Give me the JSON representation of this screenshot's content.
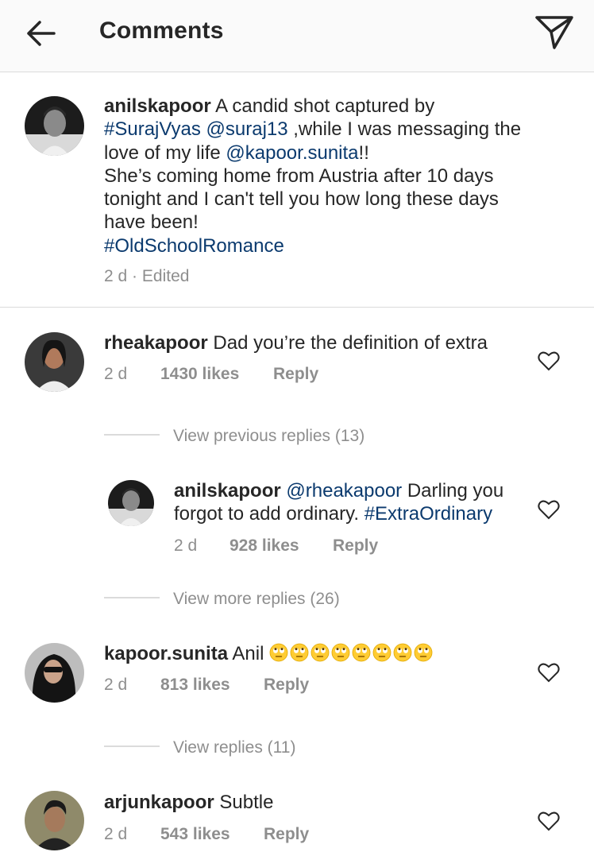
{
  "header": {
    "title": "Comments",
    "back_icon": "arrow-left-icon",
    "share_icon": "paper-plane-icon"
  },
  "caption": {
    "username": "anilskapoor",
    "text_1": " A candid shot captured by",
    "tag_1": "#SurajVyas",
    "mention_1": "@suraj13",
    "text_2": " ,while I was messaging the",
    "text_3": "love of my life ",
    "mention_2": "@kapoor.sunita",
    "text_4": "!!",
    "line_4": "She’s coming home from Austria after 10 days",
    "line_5": "tonight and I can't tell you how long these days",
    "line_6": "have been!",
    "tag_2": "#OldSchoolRomance",
    "time": "2 d",
    "separator": "·",
    "edited": "Edited"
  },
  "comments": [
    {
      "username": "rheakapoor",
      "text": " Dad you’re the definition of extra",
      "time": "2 d",
      "likes": "1430 likes",
      "reply": "Reply",
      "view_replies": "View previous replies (13)"
    },
    {
      "username": "kapoor.sunita",
      "text": " Anil ",
      "emoji": "face-with-rolling-eyes",
      "emoji_count": 8,
      "time": "2 d",
      "likes": "813 likes",
      "reply": "Reply",
      "view_replies": "View replies (11)"
    },
    {
      "username": "arjunkapoor",
      "text": " Subtle",
      "time": "2 d",
      "likes": "543 likes",
      "reply": "Reply"
    }
  ],
  "reply": {
    "username": "anilskapoor",
    "mention": "@rheakapoor",
    "text_1": " Darling you",
    "text_2": "forgot to add ordinary. ",
    "tag": "#ExtraOrdinary",
    "time": "2 d",
    "likes": "928 likes",
    "reply": "Reply",
    "view_more": "View more replies (26)"
  },
  "colors": {
    "hashtag": "#0b3a6e",
    "meta": "#8e8e8e",
    "divider": "#dbdbdb"
  }
}
